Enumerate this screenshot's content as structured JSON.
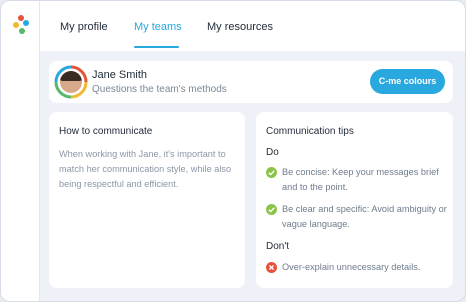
{
  "nav": {
    "tabs": [
      {
        "label": "My profile"
      },
      {
        "label": "My teams"
      },
      {
        "label": "My resources"
      }
    ],
    "active_index": 1
  },
  "profile": {
    "name": "Jane Smith",
    "subtitle": "Questions the team's methods",
    "button_label": "C-me colours"
  },
  "communicate": {
    "title": "How to communicate",
    "body": "When working with Jane, it's important to match her communication style, while also being respectful and efficient."
  },
  "tips": {
    "title": "Communication tips",
    "do_label": "Do",
    "do_items": [
      {
        "text": "Be concise: Keep your messages brief and to the point.",
        "icon": "check-icon"
      },
      {
        "text": "Be clear and specific: Avoid ambiguity or vague language.",
        "icon": "check-icon"
      }
    ],
    "dont_label": "Don't",
    "dont_items": [
      {
        "text": "Over-explain unnecessary details.",
        "icon": "cross-icon"
      }
    ]
  },
  "colors": {
    "accent": "#29a7df",
    "do": "#8bc34a",
    "dont": "#e5533d"
  }
}
